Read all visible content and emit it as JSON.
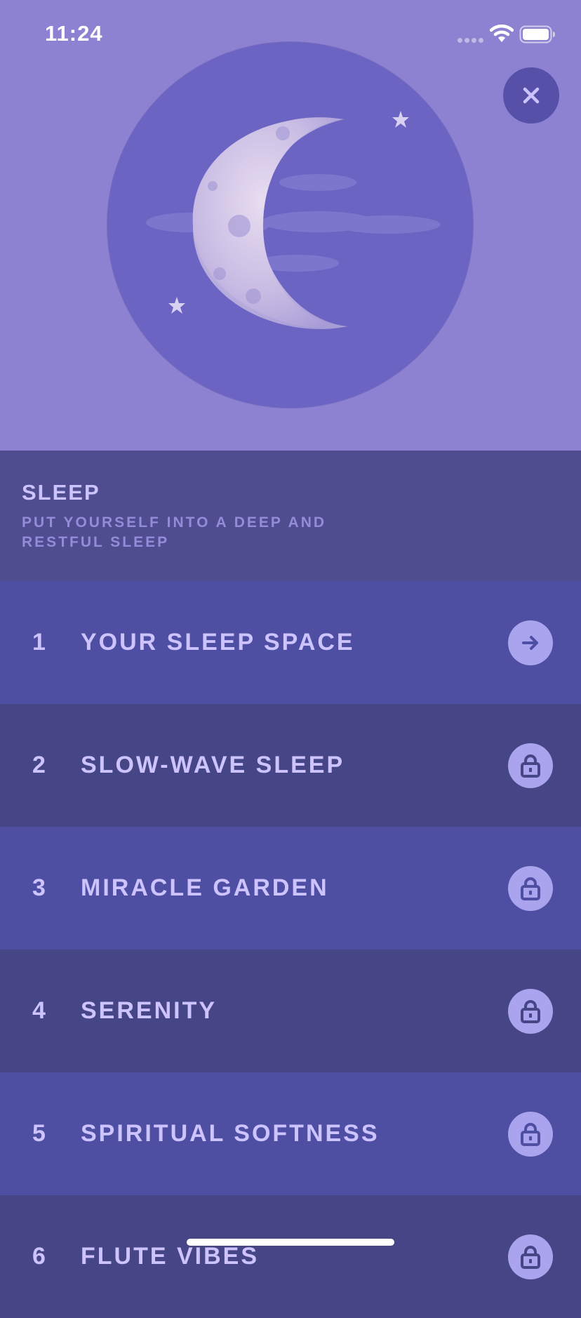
{
  "status_bar": {
    "time": "11:24",
    "icons": [
      "cellular-signal-icon",
      "wifi-icon",
      "battery-icon"
    ]
  },
  "hero": {
    "artwork": "crescent-moon-icon",
    "close_icon": "close-icon"
  },
  "category": {
    "title": "SLEEP",
    "subtitle": "PUT YOURSELF INTO A DEEP AND RESTFUL SLEEP"
  },
  "tracks": [
    {
      "number": "1",
      "title": "YOUR SLEEP SPACE",
      "icon": "arrow-right-icon",
      "locked": false
    },
    {
      "number": "2",
      "title": "SLOW-WAVE SLEEP",
      "icon": "lock-icon",
      "locked": true
    },
    {
      "number": "3",
      "title": "MIRACLE GARDEN",
      "icon": "lock-icon",
      "locked": true
    },
    {
      "number": "4",
      "title": "SERENITY",
      "icon": "lock-icon",
      "locked": true
    },
    {
      "number": "5",
      "title": "SPIRITUAL SOFTNESS",
      "icon": "lock-icon",
      "locked": true
    },
    {
      "number": "6",
      "title": "FLUTE VIBES",
      "icon": "lock-icon",
      "locked": true
    }
  ],
  "colors": {
    "hero_background": "#8c82d1",
    "artwork_circle": "#6b64c3",
    "header_background": "#4f4d8f",
    "row_odd": "#4e4fa2",
    "row_even": "#464687",
    "text_primary": "#cdc3ff",
    "text_secondary": "#938cd8",
    "action_button": "#aaa3ee"
  }
}
